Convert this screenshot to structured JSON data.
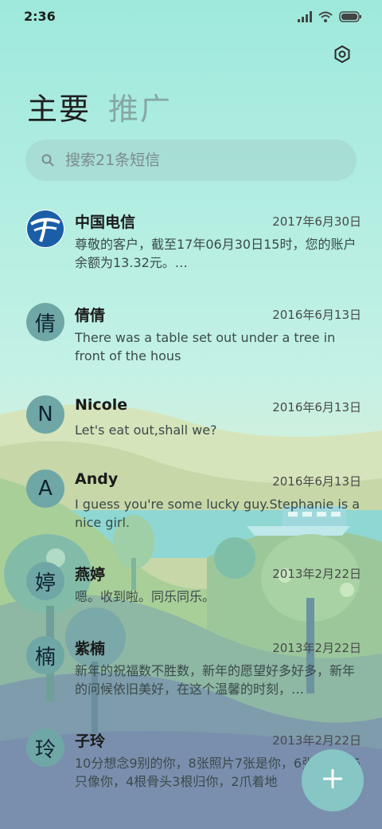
{
  "status_bar": {
    "time": "2:36"
  },
  "header": {
    "tabs": [
      "主要",
      "推广"
    ]
  },
  "search": {
    "placeholder": "搜索21条短信"
  },
  "messages": [
    {
      "avatar": "",
      "name": "中国电信",
      "date": "2017年6月30日",
      "preview": "尊敬的客户，截至17年06月30日15时，您的账户余额为13.32元。…"
    },
    {
      "avatar": "倩",
      "name": "倩倩",
      "date": "2016年6月13日",
      "preview": "There was a table set out under a tree in front of the hous"
    },
    {
      "avatar": "N",
      "name": "Nicole",
      "date": "2016年6月13日",
      "preview": "Let's eat out,shall we?"
    },
    {
      "avatar": "A",
      "name": "Andy",
      "date": "2016年6月13日",
      "preview": "I guess you're some lucky guy.Stephanie is a nice girl."
    },
    {
      "avatar": "婷",
      "name": "燕婷",
      "date": "2013年2月22日",
      "preview": "嗯。收到啦。同乐同乐。"
    },
    {
      "avatar": "楠",
      "name": "紫楠",
      "date": "2013年2月22日",
      "preview": "新年的祝福数不胜数，新年的愿望好多好多，新年的问候依旧美好，在这个温馨的时刻，…"
    },
    {
      "avatar": "玲",
      "name": "子玲",
      "date": "2013年2月22日",
      "preview": "10分想念9别的你，8张照片7张是你，6张像你，5只像你，4根骨头3根归你，2爪着地"
    }
  ],
  "icons": {
    "settings": "settings-icon",
    "search": "search-icon",
    "compose": "plus-icon",
    "carrier_logo": "china-telecom-logo"
  },
  "colors": {
    "accent": "#86c6c4",
    "avatar": "#6fa7a6"
  }
}
